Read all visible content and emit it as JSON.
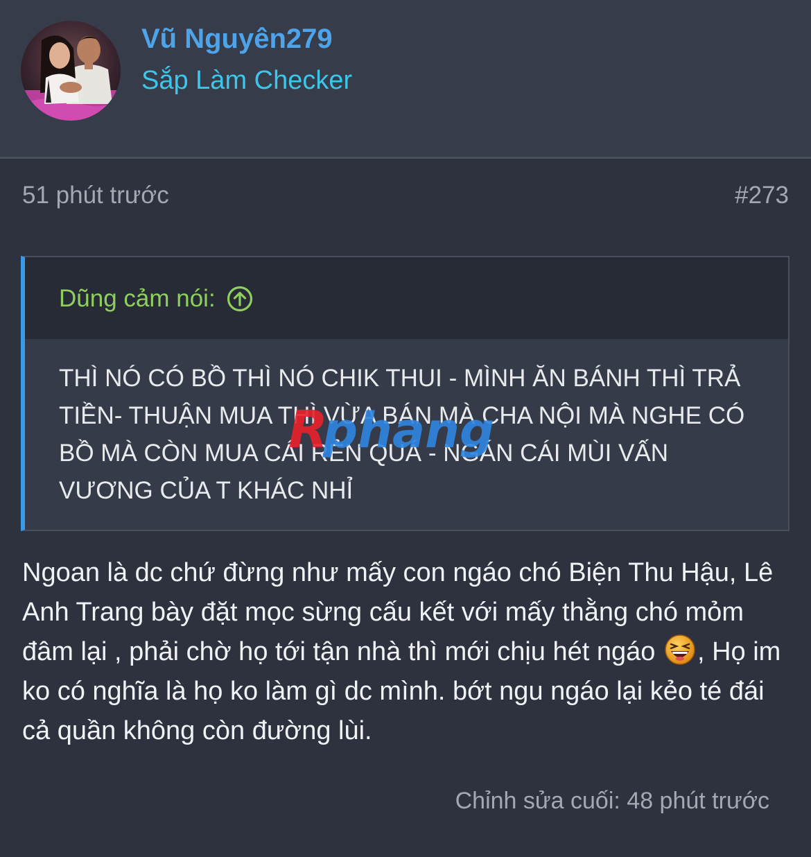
{
  "user": {
    "name": "Vũ Nguyên279",
    "title": "Sắp Làm Checker",
    "avatar_icon": "user-avatar-photo"
  },
  "post": {
    "time": "51 phút trước",
    "number": "#273",
    "quote": {
      "author_label": "Dũng cảm nói:",
      "arrow_icon": "arrow-up-circle-icon",
      "text": "THÌ NÓ CÓ BỒ THÌ NÓ CHIK THUI - MÌNH ĂN BÁNH THÌ TRẢ TIỀN- THUẬN MUA THÌ VỪA BÁN MÀ CHA NỘI MÀ NGHE CÓ BỒ MÀ CÒN MUA CÁI RẺN QUÁ - NGÁN CÁI MÙI VẤN VƯƠNG CỦA T KHÁC NHỈ"
    },
    "body_part1": "Ngoan là dc chứ đừng như mấy con ngáo chó Biện Thu Hậu, Lê Anh Trang bày đặt mọc sừng cấu kết với mấy thằng chó mỏm đâm lại , phải chờ họ tới tận nhà thì mới chịu hét ngáo ",
    "body_emoji_icon": "laughing-emoji-icon",
    "body_part2": ", Họ im ko có nghĩa là họ ko làm gì dc mình. bớt ngu ngáo lại kẻo té đái cả quần không còn đường lùi.",
    "edited": "Chỉnh sửa cuối: 48 phút trước"
  },
  "watermark": {
    "text": "Rphang",
    "colors": [
      "#e8212b",
      "#2f86e0"
    ]
  },
  "colors": {
    "background": "#2d323e",
    "header_bg": "#363c49",
    "username": "#4fa3e8",
    "user_title": "#3ec6ea",
    "quote_author": "#8fcf5f",
    "quote_bar": "#3b9ae8"
  }
}
